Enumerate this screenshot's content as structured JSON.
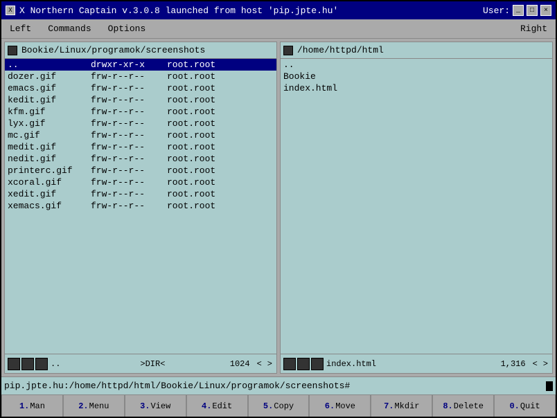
{
  "window": {
    "title": "X Northern Captain v.3.0.8  launched from host 'pip.jpte.hu'",
    "user_label": "User:"
  },
  "menu": {
    "left": "Left",
    "commands": "Commands",
    "options": "Options",
    "right": "Right"
  },
  "left_panel": {
    "path": "Bookie/Linux/programok/screenshots",
    "files": [
      {
        "name": "..",
        "perms": "drwxr-xr-x",
        "owner": "root.root",
        "selected": true
      },
      {
        "name": "dozer.gif",
        "perms": "frw-r--r--",
        "owner": "root.root",
        "selected": false
      },
      {
        "name": "emacs.gif",
        "perms": "frw-r--r--",
        "owner": "root.root",
        "selected": false
      },
      {
        "name": "kedit.gif",
        "perms": "frw-r--r--",
        "owner": "root.root",
        "selected": false
      },
      {
        "name": "kfm.gif",
        "perms": "frw-r--r--",
        "owner": "root.root",
        "selected": false
      },
      {
        "name": "lyx.gif",
        "perms": "frw-r--r--",
        "owner": "root.root",
        "selected": false
      },
      {
        "name": "mc.gif",
        "perms": "frw-r--r--",
        "owner": "root.root",
        "selected": false
      },
      {
        "name": "medit.gif",
        "perms": "frw-r--r--",
        "owner": "root.root",
        "selected": false
      },
      {
        "name": "nedit.gif",
        "perms": "frw-r--r--",
        "owner": "root.root",
        "selected": false
      },
      {
        "name": "printerc.gif",
        "perms": "frw-r--r--",
        "owner": "root.root",
        "selected": false
      },
      {
        "name": "xcoral.gif",
        "perms": "frw-r--r--",
        "owner": "root.root",
        "selected": false
      },
      {
        "name": "xedit.gif",
        "perms": "frw-r--r--",
        "owner": "root.root",
        "selected": false
      },
      {
        "name": "xemacs.gif",
        "perms": "frw-r--r--",
        "owner": "root.root",
        "selected": false
      }
    ],
    "footer": {
      "label": "..",
      "type": ">DIR<",
      "size": "1024",
      "prev": "<",
      "next": ">"
    }
  },
  "right_panel": {
    "path": "/home/httpd/html",
    "files": [
      {
        "name": "..",
        "perms": "",
        "owner": "",
        "selected": false
      },
      {
        "name": "Bookie",
        "perms": "",
        "owner": "",
        "selected": false
      },
      {
        "name": "index.html",
        "perms": "",
        "owner": "",
        "selected": false
      }
    ],
    "footer": {
      "label": "index.html",
      "size": "1,316",
      "prev": "<",
      "next": ">"
    }
  },
  "command_line": {
    "text": "pip.jpte.hu:/home/httpd/html/Bookie/Linux/programok/screenshots#"
  },
  "function_bar": {
    "buttons": [
      {
        "num": "1",
        "label": "Man"
      },
      {
        "num": "2",
        "label": "Menu"
      },
      {
        "num": "3",
        "label": "View"
      },
      {
        "num": "4",
        "label": "Edit"
      },
      {
        "num": "5",
        "label": "Copy"
      },
      {
        "num": "6",
        "label": "Move"
      },
      {
        "num": "7",
        "label": "Mkdir"
      },
      {
        "num": "8",
        "label": "Delete"
      },
      {
        "num": "0",
        "label": "Quit"
      }
    ]
  }
}
